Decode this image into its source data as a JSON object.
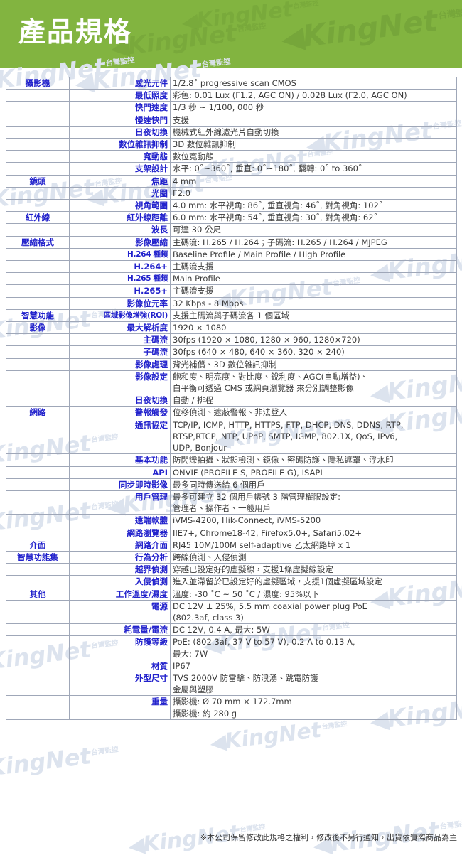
{
  "header": {
    "title": "產品規格",
    "bg_color": "#82b440",
    "title_color": "#ffffff"
  },
  "theme": {
    "label_color": "#2222cc",
    "value_color": "#3a3a3a",
    "border_color": "#9fa7b8",
    "watermark_color": "#dce3ee",
    "watermark_green": "#76a63a"
  },
  "watermark": {
    "brand": "KingNet",
    "sub": "台灣監控"
  },
  "spec_table": {
    "rows": [
      {
        "group": "攝影機",
        "label": "感光元件",
        "value": "1/2.8˚ progressive scan CMOS"
      },
      {
        "group": "",
        "label": "最低照度",
        "value": "彩色: 0.01 Lux (F1.2, AGC ON) / 0.028 Lux (F2.0, AGC ON)"
      },
      {
        "group": "",
        "label": "快門速度",
        "value": "1/3 秒 ~ 1/100, 000 秒"
      },
      {
        "group": "",
        "label": "慢速快門",
        "value": "支援"
      },
      {
        "group": "",
        "label": "日夜切換",
        "value": "機械式紅外線濾光片自動切換"
      },
      {
        "group": "",
        "label": "數位雜訊抑制",
        "value": "3D 數位雜訊抑制"
      },
      {
        "group": "",
        "label": "寬動態",
        "value": "數位寬動態"
      },
      {
        "group": "",
        "label": "支架設計",
        "value": "水平: 0˚~360˚, 垂直: 0˚~180˚, 翻轉: 0˚ to 360˚"
      },
      {
        "group": "鏡頭",
        "label": "焦距",
        "value": "4 mm"
      },
      {
        "group": "",
        "label": "光圈",
        "value": "F2.0"
      },
      {
        "group": "",
        "label": "視角範圍",
        "value": "4.0 mm: 水平視角: 86˚, 垂直視角: 46˚, 對角視角: 102˚"
      },
      {
        "group": "紅外線",
        "label": "紅外線距離",
        "value": "6.0 mm: 水平視角: 54˚, 垂直視角: 30˚, 對角視角: 62˚"
      },
      {
        "group": "",
        "label": "波長",
        "value": "可達 30 公尺"
      },
      {
        "group": "壓縮格式",
        "label": "影像壓縮",
        "value": "主碼流: H.265 / H.264；子碼流: H.265 / H.264 / MJPEG"
      },
      {
        "group": "",
        "label": "H.264 種類",
        "value": "Baseline Profile / Main Profile / High Profile"
      },
      {
        "group": "",
        "label": "H.264+",
        "value": "主碼流支援"
      },
      {
        "group": "",
        "label": "H.265 種類",
        "value": "Main Profile"
      },
      {
        "group": "",
        "label": "H.265+",
        "value": "主碼流支援"
      },
      {
        "group": "",
        "label": "影像位元率",
        "value": "32 Kbps - 8 Mbps"
      },
      {
        "group": "智慧功能",
        "label": "區域影像增強(ROI)",
        "value": "支援主碼流與子碼流各 1 個區域"
      },
      {
        "group": "影像",
        "label": "最大解析度",
        "value": "1920 × 1080"
      },
      {
        "group": "",
        "label": "主碼流",
        "value": "30fps (1920 × 1080, 1280 × 960, 1280×720)"
      },
      {
        "group": "",
        "label": "子碼流",
        "value": "30fps (640 × 480, 640 × 360, 320 × 240)"
      },
      {
        "group": "",
        "label": "影像處理",
        "value": "背光補償、3D 數位雜訊抑制"
      },
      {
        "group": "",
        "label": "影像設定",
        "value": "飽和度、明亮度、對比度、銳利度、AGC(自動增益)、\n白平衡可透過 CMS 或網頁瀏覽器 來分別調整影像"
      },
      {
        "group": "",
        "label": "日夜切換",
        "value": "自動 / 排程"
      },
      {
        "group": "網路",
        "label": "警報觸發",
        "value": "位移偵測、遮蔽警報、非法登入"
      },
      {
        "group": "",
        "label": "通訊協定",
        "value": "TCP/IP, ICMP, HTTP, HTTPS, FTP, DHCP, DNS, DDNS, RTP,\nRTSP,RTCP, NTP, UPnP, SMTP, IGMP, 802.1X, QoS, IPv6,\nUDP, Bonjour"
      },
      {
        "group": "",
        "label": "基本功能",
        "value": "防閃爍拍攝、狀態檢測、鏡像、密碼防護、隱私遮罩、浮水印"
      },
      {
        "group": "",
        "label": "API",
        "value": "ONVIF (PROFILE S, PROFILE G), ISAPI"
      },
      {
        "group": "",
        "label": "同步即時影像",
        "value": "最多同時傳送給 6 個用戶"
      },
      {
        "group": "",
        "label": "用戶管理",
        "value": "最多可建立 32 個用戶帳號 3 階管理權限設定:\n管理者、操作者、一般用戶"
      },
      {
        "group": "",
        "label": "遠端軟體",
        "value": "iVMS-4200, Hik-Connect, iVMS-5200"
      },
      {
        "group": "",
        "label": "網路瀏覽器",
        "value": "IIE7+, Chrome18-42, Firefox5.0+, Safari5.02+"
      },
      {
        "group": "介面",
        "label": "網路介面",
        "value": "RJ45 10M/100M self-adaptive 乙太網路埠 x 1"
      },
      {
        "group": "智慧功能集",
        "label": "行為分析",
        "value": "跨線偵測、入侵偵測"
      },
      {
        "group": "",
        "label": "越界偵測",
        "value": "穿越已設定好的虛擬線，支援1條虛擬線設定"
      },
      {
        "group": "",
        "label": "入侵偵測",
        "value": "進入並滯留於已設定好的虛擬區域，支援1個虛擬區域設定"
      },
      {
        "group": "其他",
        "label": "工作溫度/濕度",
        "value": "溫度: -30 ˚C ~ 50 ˚C / 濕度: 95%以下"
      },
      {
        "group": "",
        "label": "電源",
        "value": "DC 12V ± 25%, 5.5 mm coaxial power plug PoE\n(802.3af, class 3)"
      },
      {
        "group": "",
        "label": "耗電量/電流",
        "value": "DC 12V, 0.4 A, 最大: 5W"
      },
      {
        "group": "",
        "label": "防護等級",
        "value": "PoE: (802.3af, 37 V to 57 V), 0.2 A to 0.13 A,\n最大: 7W"
      },
      {
        "group": "",
        "label": "材質",
        "value": "IP67"
      },
      {
        "group": "",
        "label": "外型尺寸",
        "value": "TVS 2000V 防雷擊、防浪湧、跳電防護\n金屬與塑膠"
      },
      {
        "group": "",
        "label": "重量",
        "value": "攝影機: Ø 70 mm × 172.7mm\n攝影機: 約 280 g"
      }
    ]
  },
  "footnote": "※本公司保留修改此規格之權利，修改後不另行通知，出貨依實際商品為主"
}
